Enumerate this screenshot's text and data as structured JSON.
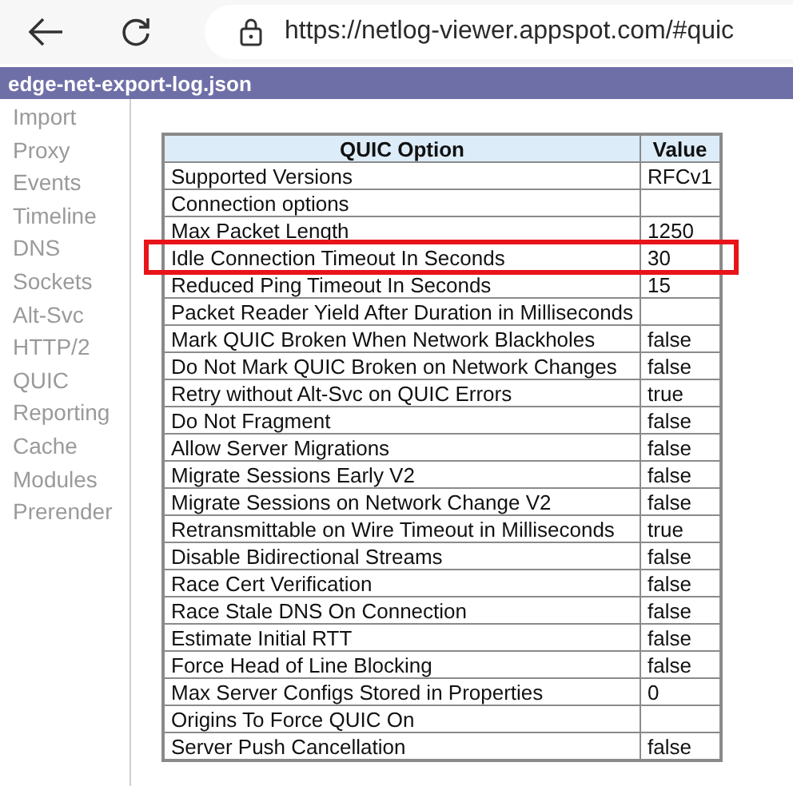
{
  "browser": {
    "url": "https://netlog-viewer.appspot.com/#quic"
  },
  "title_bar": {
    "title": "edge-net-export-log.json"
  },
  "sidebar": {
    "items": [
      {
        "label": "Import",
        "selected": false
      },
      {
        "label": "Proxy",
        "selected": false
      },
      {
        "label": "Events",
        "selected": false
      },
      {
        "label": "Timeline",
        "selected": false
      },
      {
        "label": "DNS",
        "selected": false
      },
      {
        "label": "Sockets",
        "selected": false
      },
      {
        "label": "Alt-Svc",
        "selected": false
      },
      {
        "label": "HTTP/2",
        "selected": false
      },
      {
        "label": "QUIC",
        "selected": false
      },
      {
        "label": "Reporting",
        "selected": false
      },
      {
        "label": "Cache",
        "selected": false
      },
      {
        "label": "Modules",
        "selected": false
      },
      {
        "label": "Prerender",
        "selected": false
      }
    ]
  },
  "table": {
    "columns": [
      "QUIC Option",
      "Value"
    ],
    "rows": [
      {
        "option": "Supported Versions",
        "value": "RFCv1",
        "highlighted": false
      },
      {
        "option": "Connection options",
        "highlighted": false
      },
      {
        "option": "Max Packet Length",
        "value": "1250",
        "highlighted": false
      },
      {
        "option": "Idle Connection Timeout In Seconds",
        "value": "30",
        "highlighted": true
      },
      {
        "option": "Reduced Ping Timeout In Seconds",
        "value": "15",
        "highlighted": false
      },
      {
        "option": "Packet Reader Yield After Duration in Milliseconds",
        "highlighted": false
      },
      {
        "option": "Mark QUIC Broken When Network Blackholes",
        "value": "false",
        "highlighted": false
      },
      {
        "option": "Do Not Mark QUIC Broken on Network Changes",
        "value": "false",
        "highlighted": false
      },
      {
        "option": "Retry without Alt-Svc on QUIC Errors",
        "value": "true",
        "highlighted": false
      },
      {
        "option": "Do Not Fragment",
        "value": "false",
        "highlighted": false
      },
      {
        "option": "Allow Server Migrations",
        "value": "false",
        "highlighted": false
      },
      {
        "option": "Migrate Sessions Early V2",
        "value": "false",
        "highlighted": false
      },
      {
        "option": "Migrate Sessions on Network Change V2",
        "value": "false",
        "highlighted": false
      },
      {
        "option": "Retransmittable on Wire Timeout in Milliseconds",
        "value": "true",
        "highlighted": false
      },
      {
        "option": "Disable Bidirectional Streams",
        "value": "false",
        "highlighted": false
      },
      {
        "option": "Race Cert Verification",
        "value": "false",
        "highlighted": false
      },
      {
        "option": "Race Stale DNS On Connection",
        "value": "false",
        "highlighted": false
      },
      {
        "option": "Estimate Initial RTT",
        "value": "false",
        "highlighted": false
      },
      {
        "option": "Force Head of Line Blocking",
        "value": "false",
        "highlighted": false
      },
      {
        "option": "Max Server Configs Stored in Properties",
        "value": "0",
        "highlighted": false
      },
      {
        "option": "Origins To Force QUIC On",
        "highlighted": false
      },
      {
        "option": "Server Push Cancellation",
        "value": "false",
        "highlighted": false
      }
    ]
  }
}
